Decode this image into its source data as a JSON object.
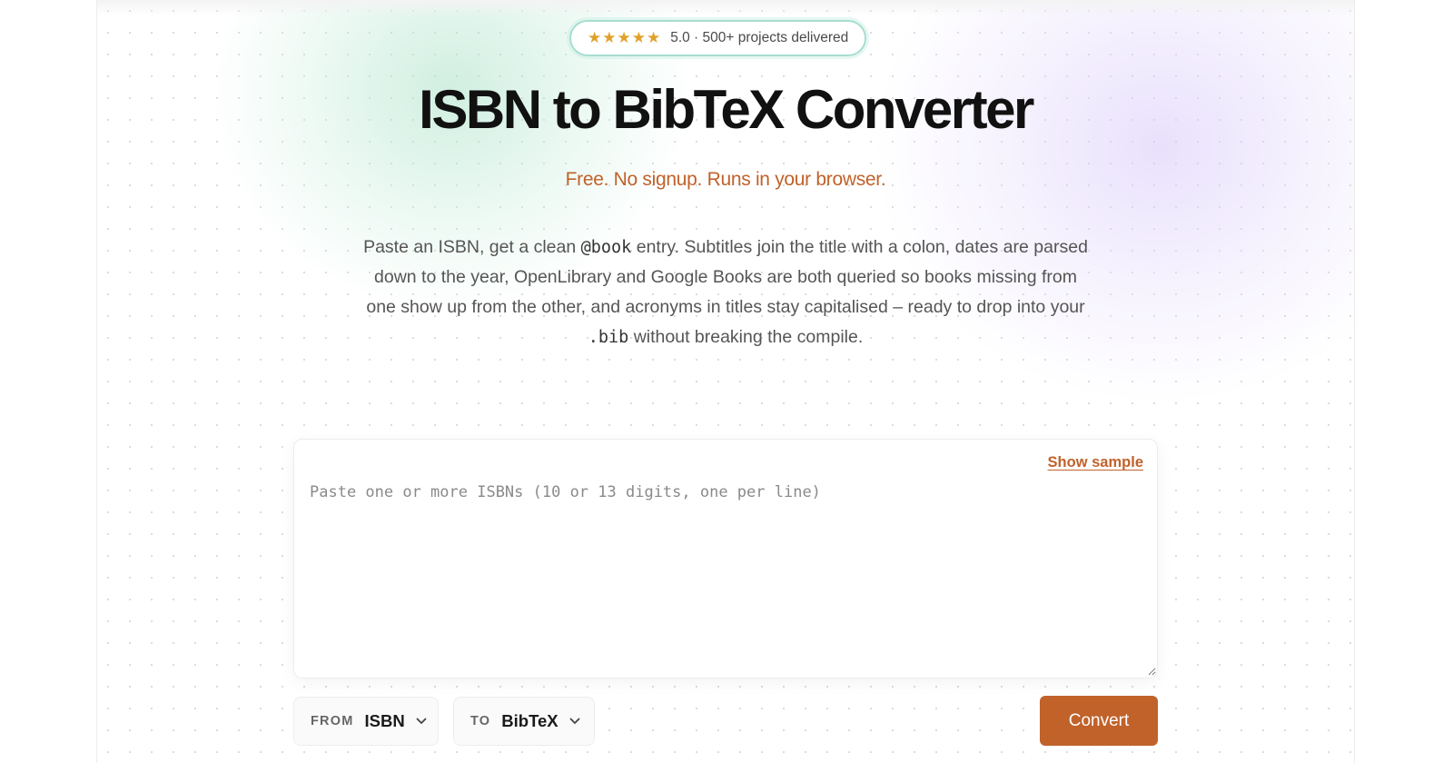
{
  "rating": {
    "stars": "★★★★★",
    "text": "5.0 · 500+ projects delivered"
  },
  "hero": {
    "title": "ISBN to BibTeX Converter",
    "tagline": "Free. No signup. Runs in your browser.",
    "description_part1": "Paste an ISBN, get a clean ",
    "description_code1": "@book",
    "description_part2": " entry. Subtitles join the title with a colon, dates are parsed down to the year, OpenLibrary and Google Books are both queried so books missing from one show up from the other, and acronyms in titles stay capitalised – ready to drop into your ",
    "description_code2": ".bib",
    "description_part3": " without breaking the compile."
  },
  "converter": {
    "show_sample_label": "Show sample",
    "input_value": "",
    "input_placeholder": "Paste one or more ISBNs (10 or 13 digits, one per line)",
    "from_label": "FROM",
    "from_value": "ISBN",
    "to_label": "TO",
    "to_value": "BibTeX",
    "convert_label": "Convert"
  },
  "colors": {
    "accent": "#c0622a",
    "star": "#e0a12b",
    "pill_border": "#a8ddd0"
  }
}
